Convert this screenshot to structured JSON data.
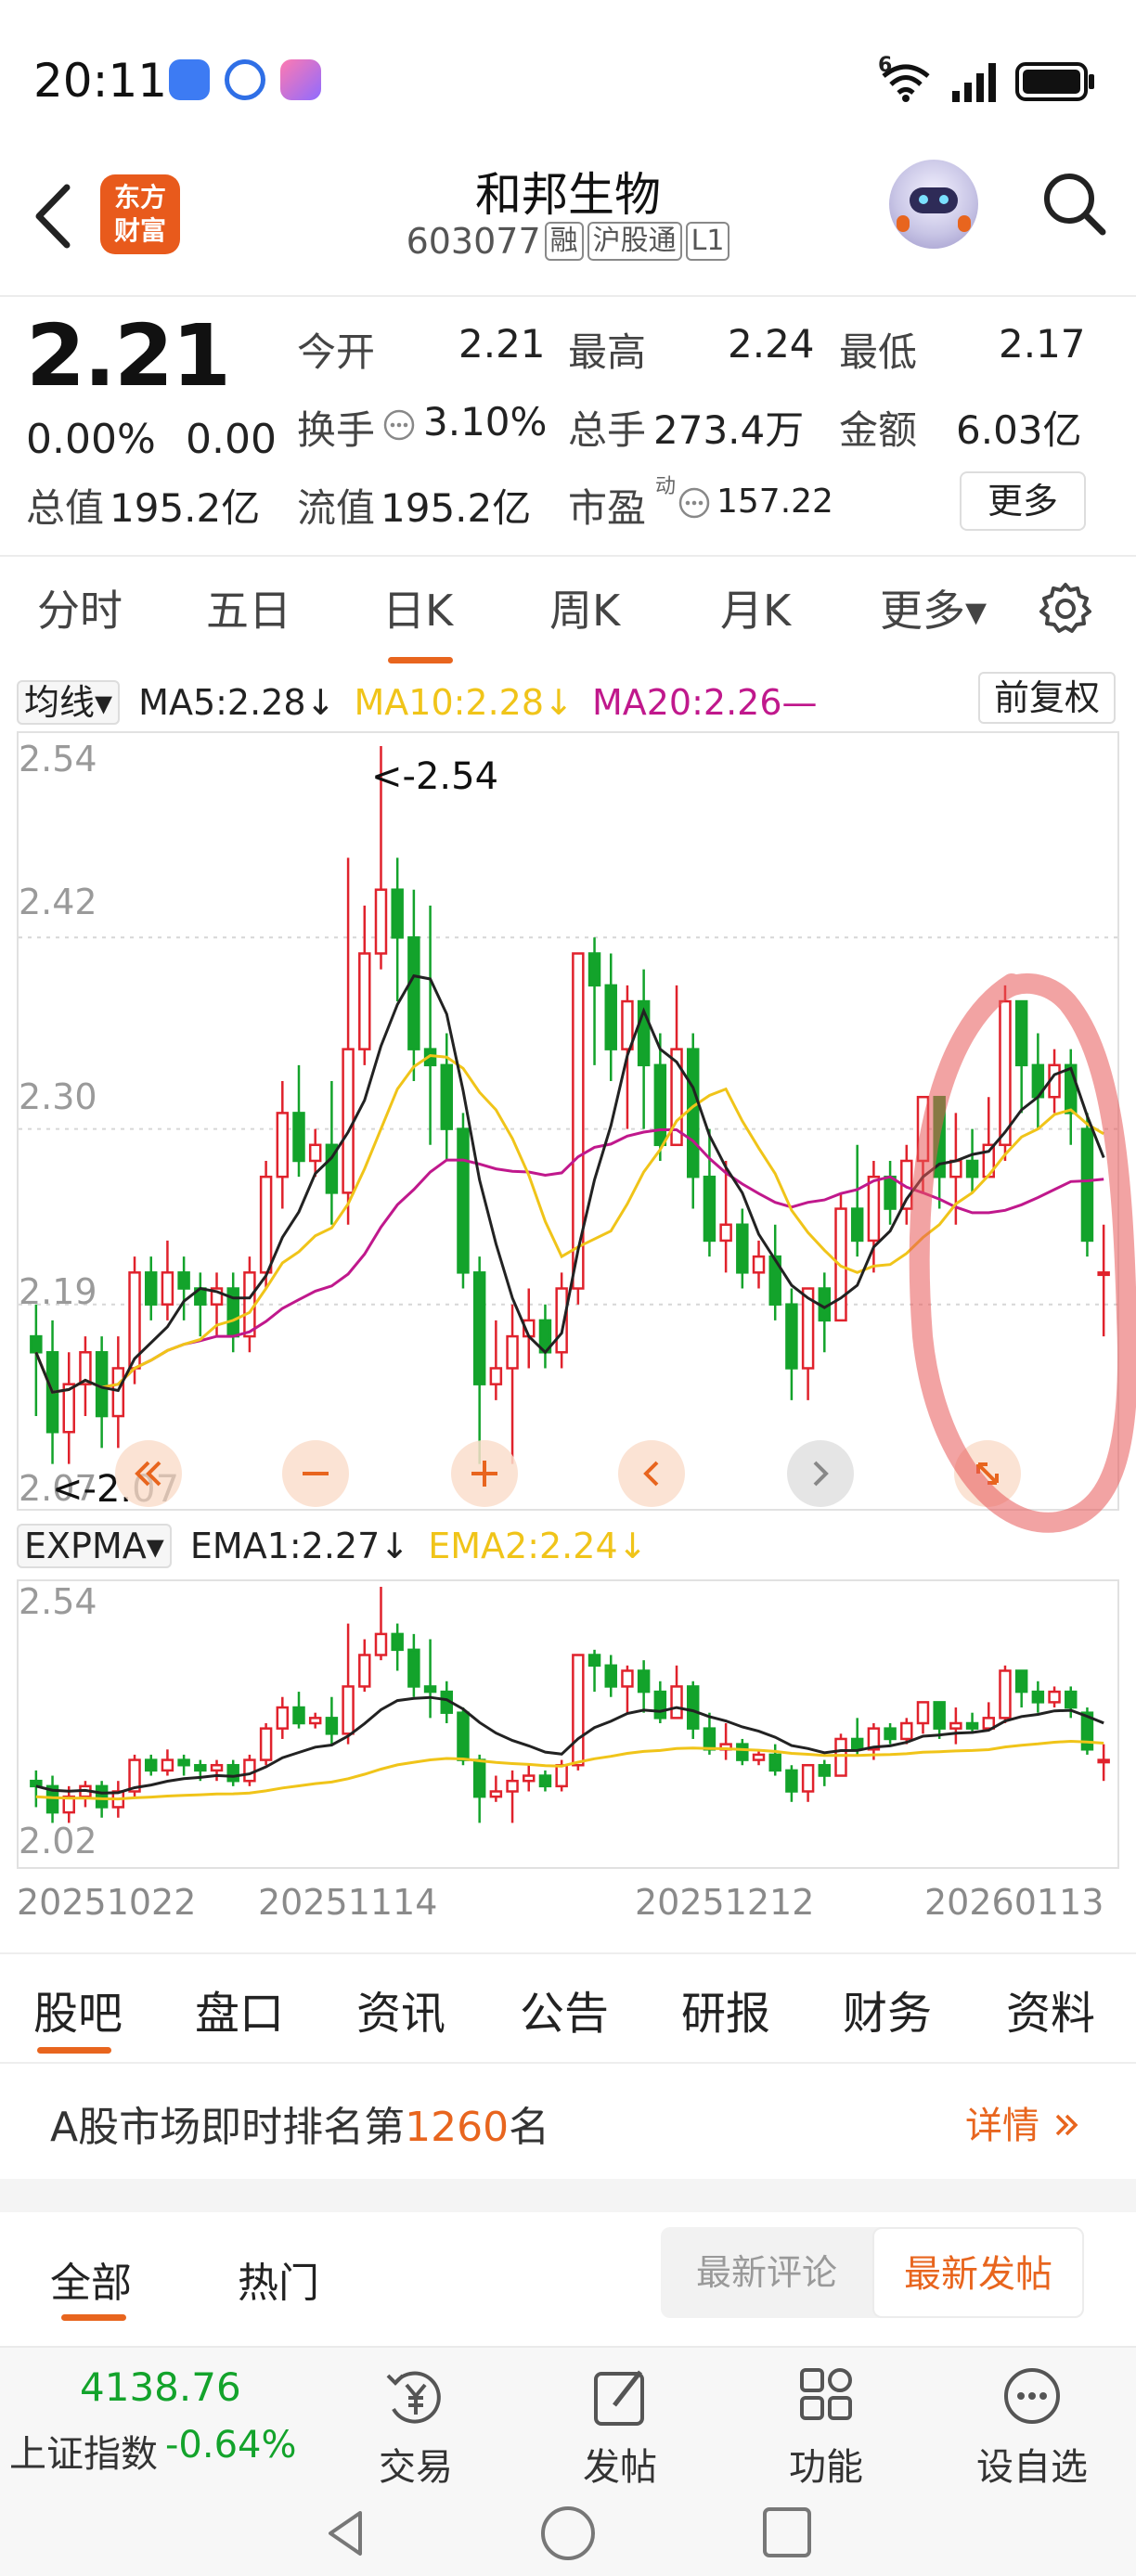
{
  "status_bar": {
    "time": "20:11",
    "network": "6"
  },
  "header": {
    "back_icon": "back-chevron",
    "logo_line1": "东方",
    "logo_line2": "财富",
    "stock_name": "和邦生物",
    "stock_code": "603077",
    "tags": [
      "融",
      "沪股通",
      "L1"
    ],
    "search_icon": "search-icon"
  },
  "quote": {
    "price": "2.21",
    "change_pct": "0.00%",
    "change": "0.00",
    "open_label": "今开",
    "open_value": "2.21",
    "high_label": "最高",
    "high_value": "2.24",
    "low_label": "最低",
    "low_value": "2.17",
    "turnover_label": "换手",
    "turnover_value": "3.10%",
    "volume_label": "总手",
    "volume_value": "273.4万",
    "amount_label": "金额",
    "amount_value": "6.03亿",
    "mktcap_label": "总值",
    "mktcap_value": "195.2亿",
    "float_label": "流值",
    "float_value": "195.2亿",
    "pe_label": "市盈",
    "pe_super": "动",
    "pe_value": "157.22",
    "more_label": "更多"
  },
  "period_tabs": {
    "items": [
      "分时",
      "五日",
      "日K",
      "周K",
      "月K",
      "更多▾"
    ],
    "active": "日K"
  },
  "main_indicator": {
    "selector": "均线▾",
    "ma5": "MA5:2.28↓",
    "ma10": "MA10:2.28↓",
    "ma20": "MA20:2.26—",
    "adjust_btn": "前复权",
    "y_labels": [
      "2.54",
      "2.42",
      "2.30",
      "2.19",
      "2.07"
    ],
    "high_marker": "<-2.54",
    "low_marker": "<-2.07"
  },
  "sub_indicator": {
    "selector": "EXPMA▾",
    "ema1": "EMA1:2.27↓",
    "ema2": "EMA2:2.24↓",
    "y_top": "2.54",
    "y_bottom": "2.02"
  },
  "dates": [
    "20251022",
    "20251114",
    "20251212",
    "20260113"
  ],
  "colors": {
    "up": "#e0222c",
    "down": "#13a32b",
    "ma5": "#222222",
    "ma10": "#f0c419",
    "ma20": "#c0188c",
    "accent": "#e8651e"
  },
  "chart_data": {
    "type": "candlestick",
    "series_names": [
      "MA5",
      "MA10",
      "MA20"
    ],
    "ylim": [
      2.07,
      2.54
    ],
    "candles": [
      {
        "o": 2.17,
        "c": 2.16,
        "h": 2.19,
        "l": 2.12
      },
      {
        "o": 2.16,
        "c": 2.11,
        "h": 2.18,
        "l": 2.09
      },
      {
        "o": 2.11,
        "c": 2.14,
        "h": 2.16,
        "l": 2.09
      },
      {
        "o": 2.14,
        "c": 2.16,
        "h": 2.17,
        "l": 2.12
      },
      {
        "o": 2.16,
        "c": 2.12,
        "h": 2.17,
        "l": 2.1
      },
      {
        "o": 2.12,
        "c": 2.15,
        "h": 2.17,
        "l": 2.1
      },
      {
        "o": 2.15,
        "c": 2.21,
        "h": 2.22,
        "l": 2.14
      },
      {
        "o": 2.21,
        "c": 2.19,
        "h": 2.22,
        "l": 2.18
      },
      {
        "o": 2.19,
        "c": 2.21,
        "h": 2.23,
        "l": 2.18
      },
      {
        "o": 2.21,
        "c": 2.2,
        "h": 2.22,
        "l": 2.18
      },
      {
        "o": 2.2,
        "c": 2.19,
        "h": 2.21,
        "l": 2.17
      },
      {
        "o": 2.19,
        "c": 2.2,
        "h": 2.21,
        "l": 2.17
      },
      {
        "o": 2.2,
        "c": 2.17,
        "h": 2.21,
        "l": 2.16
      },
      {
        "o": 2.17,
        "c": 2.21,
        "h": 2.22,
        "l": 2.16
      },
      {
        "o": 2.21,
        "c": 2.27,
        "h": 2.28,
        "l": 2.2
      },
      {
        "o": 2.27,
        "c": 2.31,
        "h": 2.33,
        "l": 2.25
      },
      {
        "o": 2.31,
        "c": 2.28,
        "h": 2.34,
        "l": 2.27
      },
      {
        "o": 2.28,
        "c": 2.29,
        "h": 2.3,
        "l": 2.27
      },
      {
        "o": 2.29,
        "c": 2.26,
        "h": 2.33,
        "l": 2.24
      },
      {
        "o": 2.26,
        "c": 2.35,
        "h": 2.47,
        "l": 2.24
      },
      {
        "o": 2.35,
        "c": 2.41,
        "h": 2.44,
        "l": 2.34
      },
      {
        "o": 2.41,
        "c": 2.45,
        "h": 2.54,
        "l": 2.4
      },
      {
        "o": 2.45,
        "c": 2.42,
        "h": 2.47,
        "l": 2.38
      },
      {
        "o": 2.42,
        "c": 2.35,
        "h": 2.45,
        "l": 2.33
      },
      {
        "o": 2.35,
        "c": 2.34,
        "h": 2.44,
        "l": 2.29
      },
      {
        "o": 2.34,
        "c": 2.3,
        "h": 2.36,
        "l": 2.28
      },
      {
        "o": 2.3,
        "c": 2.21,
        "h": 2.31,
        "l": 2.2
      },
      {
        "o": 2.21,
        "c": 2.14,
        "h": 2.22,
        "l": 2.09
      },
      {
        "o": 2.14,
        "c": 2.15,
        "h": 2.18,
        "l": 2.13
      },
      {
        "o": 2.15,
        "c": 2.17,
        "h": 2.19,
        "l": 2.09
      },
      {
        "o": 2.17,
        "c": 2.18,
        "h": 2.2,
        "l": 2.15
      },
      {
        "o": 2.18,
        "c": 2.16,
        "h": 2.19,
        "l": 2.15
      },
      {
        "o": 2.16,
        "c": 2.2,
        "h": 2.21,
        "l": 2.15
      },
      {
        "o": 2.2,
        "c": 2.41,
        "h": 2.41,
        "l": 2.19
      },
      {
        "o": 2.41,
        "c": 2.39,
        "h": 2.42,
        "l": 2.34
      },
      {
        "o": 2.39,
        "c": 2.35,
        "h": 2.41,
        "l": 2.33
      },
      {
        "o": 2.35,
        "c": 2.38,
        "h": 2.39,
        "l": 2.3
      },
      {
        "o": 2.38,
        "c": 2.34,
        "h": 2.4,
        "l": 2.3
      },
      {
        "o": 2.34,
        "c": 2.29,
        "h": 2.36,
        "l": 2.28
      },
      {
        "o": 2.29,
        "c": 2.35,
        "h": 2.39,
        "l": 2.29
      },
      {
        "o": 2.35,
        "c": 2.27,
        "h": 2.36,
        "l": 2.25
      },
      {
        "o": 2.27,
        "c": 2.23,
        "h": 2.3,
        "l": 2.22
      },
      {
        "o": 2.23,
        "c": 2.24,
        "h": 2.28,
        "l": 2.21
      },
      {
        "o": 2.24,
        "c": 2.21,
        "h": 2.25,
        "l": 2.2
      },
      {
        "o": 2.21,
        "c": 2.22,
        "h": 2.23,
        "l": 2.2
      },
      {
        "o": 2.22,
        "c": 2.19,
        "h": 2.24,
        "l": 2.18
      },
      {
        "o": 2.19,
        "c": 2.15,
        "h": 2.2,
        "l": 2.13
      },
      {
        "o": 2.15,
        "c": 2.2,
        "h": 2.2,
        "l": 2.13
      },
      {
        "o": 2.2,
        "c": 2.18,
        "h": 2.21,
        "l": 2.16
      },
      {
        "o": 2.18,
        "c": 2.25,
        "h": 2.26,
        "l": 2.18
      },
      {
        "o": 2.25,
        "c": 2.23,
        "h": 2.29,
        "l": 2.22
      },
      {
        "o": 2.23,
        "c": 2.27,
        "h": 2.28,
        "l": 2.21
      },
      {
        "o": 2.27,
        "c": 2.25,
        "h": 2.28,
        "l": 2.24
      },
      {
        "o": 2.25,
        "c": 2.28,
        "h": 2.29,
        "l": 2.24
      },
      {
        "o": 2.28,
        "c": 2.32,
        "h": 2.32,
        "l": 2.26
      },
      {
        "o": 2.32,
        "c": 2.27,
        "h": 2.32,
        "l": 2.25
      },
      {
        "o": 2.27,
        "c": 2.28,
        "h": 2.31,
        "l": 2.24
      },
      {
        "o": 2.28,
        "c": 2.27,
        "h": 2.3,
        "l": 2.26
      },
      {
        "o": 2.27,
        "c": 2.29,
        "h": 2.32,
        "l": 2.27
      },
      {
        "o": 2.29,
        "c": 2.38,
        "h": 2.39,
        "l": 2.28
      },
      {
        "o": 2.38,
        "c": 2.34,
        "h": 2.38,
        "l": 2.31
      },
      {
        "o": 2.34,
        "c": 2.32,
        "h": 2.36,
        "l": 2.3
      },
      {
        "o": 2.32,
        "c": 2.34,
        "h": 2.35,
        "l": 2.31
      },
      {
        "o": 2.34,
        "c": 2.31,
        "h": 2.35,
        "l": 2.29
      },
      {
        "o": 2.3,
        "c": 2.23,
        "h": 2.31,
        "l": 2.22
      },
      {
        "o": 2.21,
        "c": 2.21,
        "h": 2.24,
        "l": 2.17
      }
    ]
  }
}
